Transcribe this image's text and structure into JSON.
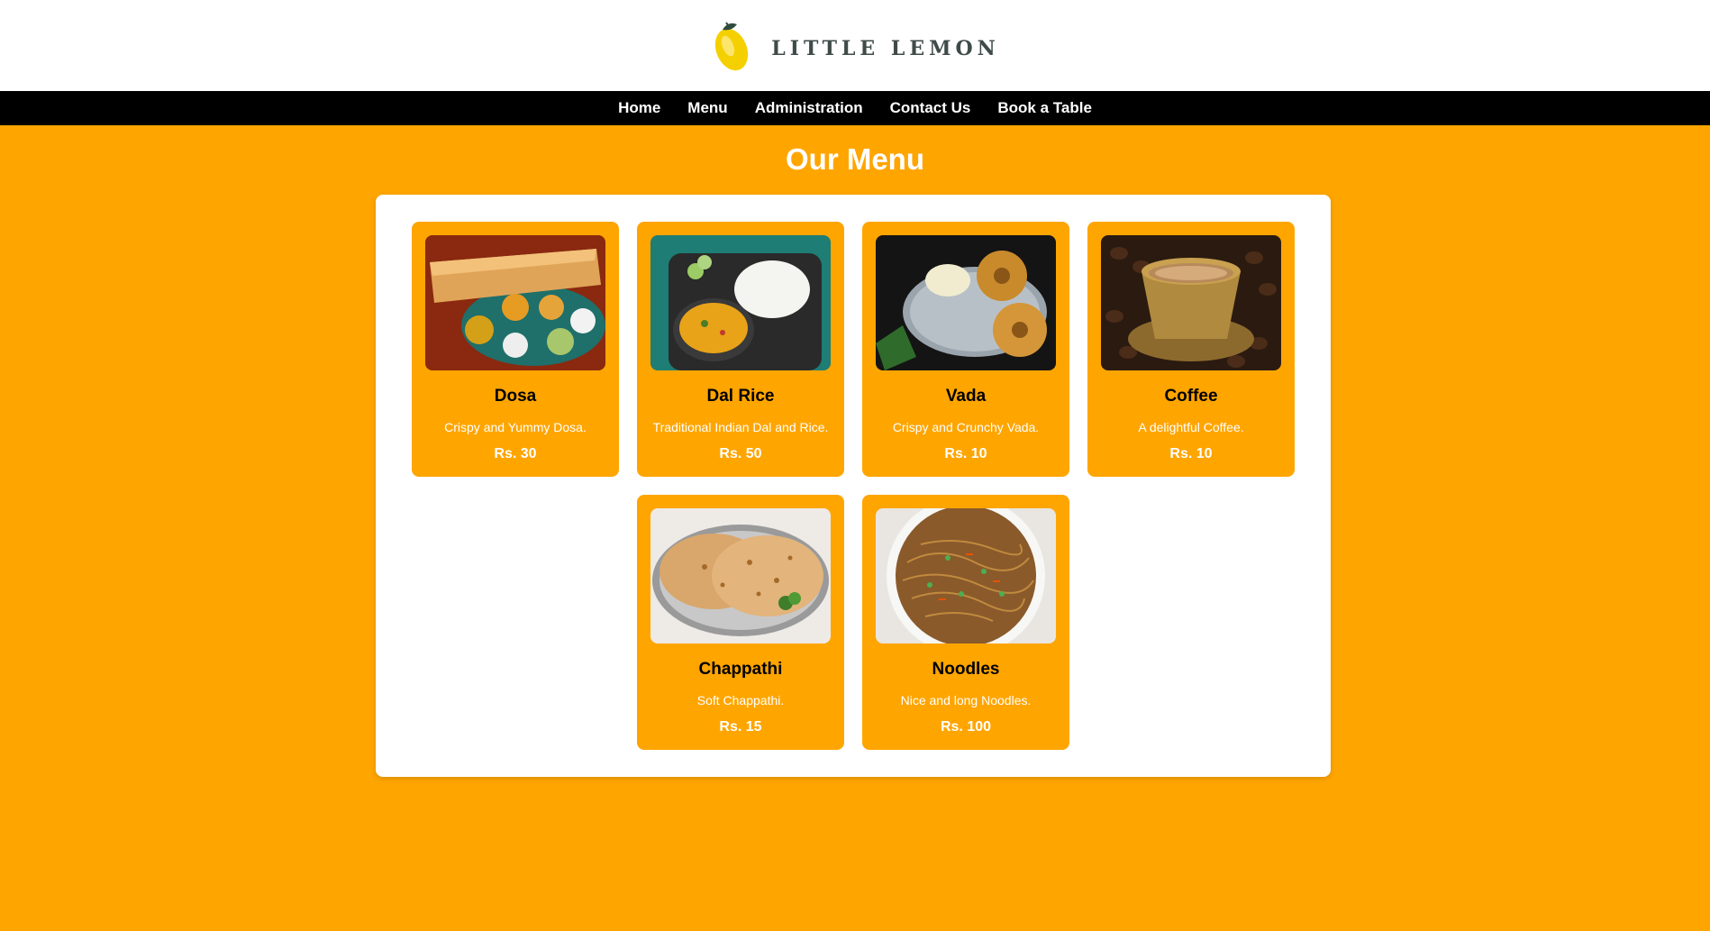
{
  "brand": {
    "name": "LITTLE LEMON",
    "logo_icon": "lemon-icon"
  },
  "nav": {
    "items": [
      {
        "label": "Home"
      },
      {
        "label": "Menu"
      },
      {
        "label": "Administration"
      },
      {
        "label": "Contact Us"
      },
      {
        "label": "Book a Table"
      }
    ]
  },
  "page": {
    "title": "Our Menu"
  },
  "menu": {
    "items": [
      {
        "name": "Dosa",
        "description": "Crispy and Yummy Dosa.",
        "price": "Rs. 30",
        "image": "dosa-photo"
      },
      {
        "name": "Dal Rice",
        "description": "Traditional Indian Dal and Rice.",
        "price": "Rs. 50",
        "image": "dal-rice-photo"
      },
      {
        "name": "Vada",
        "description": "Crispy and Crunchy Vada.",
        "price": "Rs. 10",
        "image": "vada-photo"
      },
      {
        "name": "Coffee",
        "description": "A delightful Coffee.",
        "price": "Rs. 10",
        "image": "coffee-photo"
      },
      {
        "name": "Chappathi",
        "description": "Soft Chappathi.",
        "price": "Rs. 15",
        "image": "chappathi-photo"
      },
      {
        "name": "Noodles",
        "description": "Nice and long Noodles.",
        "price": "Rs. 100",
        "image": "noodles-photo"
      }
    ]
  },
  "colors": {
    "background": "#FFA500",
    "nav": "#000000",
    "panel": "#FFFFFF",
    "brand_text": "#3F4B49",
    "lemon": "#F5D000"
  }
}
